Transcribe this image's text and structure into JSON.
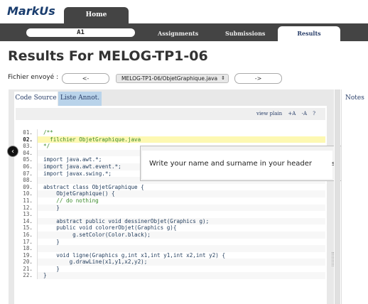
{
  "app": {
    "logo": "MarkUs"
  },
  "nav": {
    "home": "Home",
    "assignment": "A1",
    "assignments": "Assignments",
    "submissions": "Submissions",
    "results": "Results"
  },
  "page": {
    "title": "Results For MELOG-TP1-06"
  },
  "file_nav": {
    "label": "Fichier envoyé :",
    "prev": "<-",
    "selected_file": "MELOG-TP1-06/ObjetGraphique.java",
    "next": "->"
  },
  "tabs": {
    "code_source": "Code Source",
    "annotations": "Liste Annot."
  },
  "toolbar": {
    "view_plain": "view plain",
    "font_up": "+A",
    "font_down": "-A",
    "help": "?"
  },
  "code": {
    "highlighted_line": 2,
    "lines": [
      {
        "n": "01.",
        "t": "/**"
      },
      {
        "n": "02.",
        "t": "  filchier ObjetGraphique.java"
      },
      {
        "n": "03.",
        "t": "*/"
      },
      {
        "n": "04.",
        "t": ""
      },
      {
        "n": "05.",
        "t": "import java.awt.*;"
      },
      {
        "n": "06.",
        "t": "import java.awt.event.*;"
      },
      {
        "n": "07.",
        "t": "import javax.swing.*;"
      },
      {
        "n": "08.",
        "t": ""
      },
      {
        "n": "09.",
        "t": "abstract class ObjetGraphique {"
      },
      {
        "n": "10.",
        "t": "    ObjetGraphique() {"
      },
      {
        "n": "11.",
        "t": "    // do nothing"
      },
      {
        "n": "12.",
        "t": "    }"
      },
      {
        "n": "13.",
        "t": ""
      },
      {
        "n": "14.",
        "t": "    abstract public void dessinerObjet(Graphics g);"
      },
      {
        "n": "15.",
        "t": "    public void colorerObjet(Graphics g){"
      },
      {
        "n": "16.",
        "t": "         g.setColor(Color.black);"
      },
      {
        "n": "17.",
        "t": "    }"
      },
      {
        "n": "18.",
        "t": ""
      },
      {
        "n": "19.",
        "t": "    void ligne(Graphics g,int x1,int y1,int x2,int y2) {"
      },
      {
        "n": "20.",
        "t": "        g.drawLine(x1,y1,x2,y2);"
      },
      {
        "n": "21.",
        "t": "    }"
      },
      {
        "n": "22.",
        "t": "}"
      }
    ]
  },
  "annotation_popup": {
    "text": "Write your name and surname in your header",
    "trailing": "s"
  },
  "notes": {
    "label": "Notes"
  }
}
